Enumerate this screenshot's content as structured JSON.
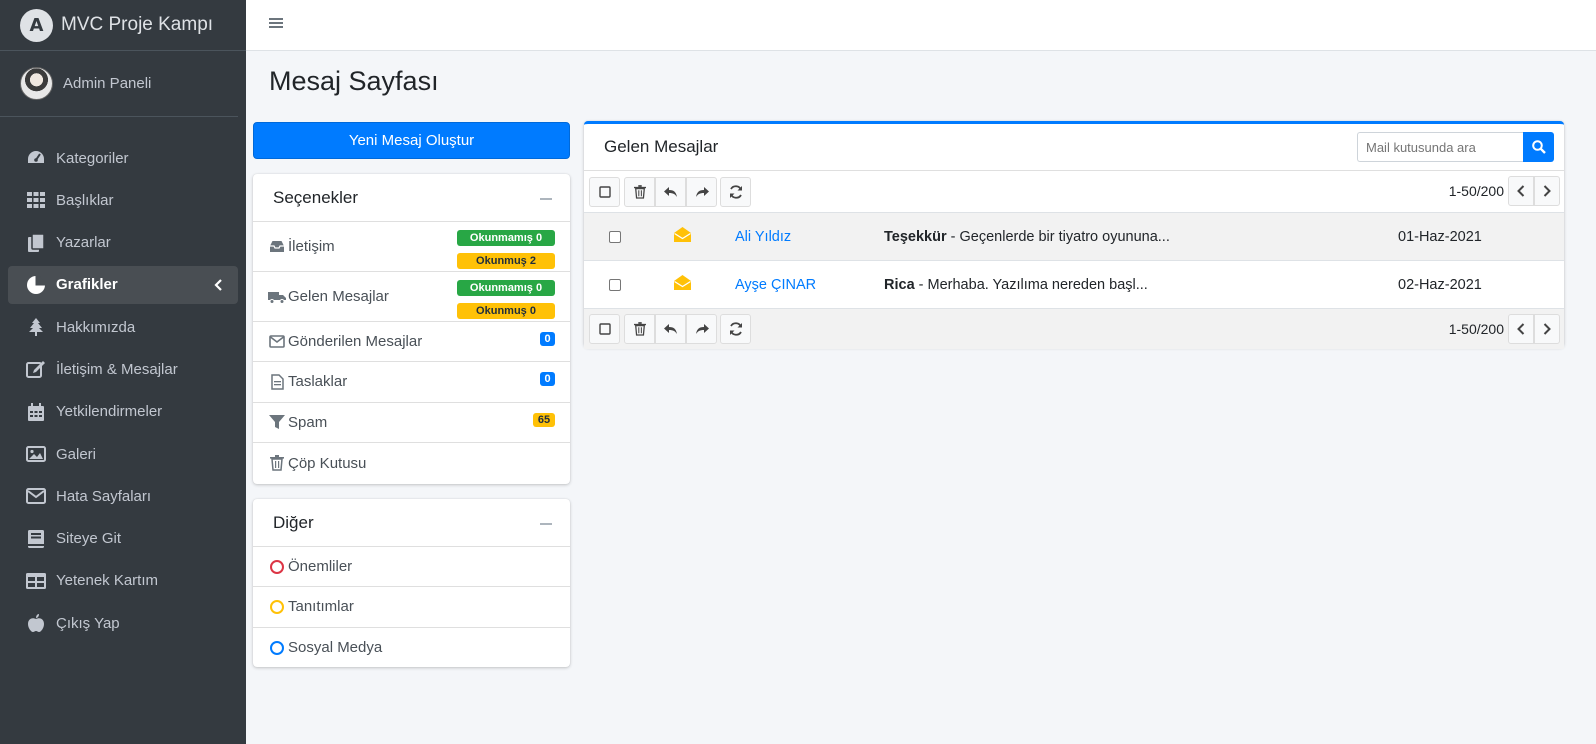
{
  "brand": {
    "logo_letter": "A",
    "title": "MVC Proje Kampı"
  },
  "user": {
    "name": "Admin Paneli"
  },
  "nav": [
    {
      "label": "Kategoriler",
      "icon": "dashboard-icon"
    },
    {
      "label": "Başlıklar",
      "icon": "grid-icon"
    },
    {
      "label": "Yazarlar",
      "icon": "copy-icon"
    },
    {
      "label": "Grafikler",
      "icon": "pie-chart-icon",
      "active": true
    },
    {
      "label": "Hakkımızda",
      "icon": "tree-icon"
    },
    {
      "label": "İletişim & Mesajlar",
      "icon": "edit-icon"
    },
    {
      "label": "Yetkilendirmeler",
      "icon": "calendar-icon"
    },
    {
      "label": "Galeri",
      "icon": "image-icon"
    },
    {
      "label": "Hata Sayfaları",
      "icon": "envelope-icon"
    },
    {
      "label": "Siteye Git",
      "icon": "book-icon"
    },
    {
      "label": "Yetenek Kartım",
      "icon": "table-icon"
    },
    {
      "label": "Çıkış Yap",
      "icon": "apple-icon"
    }
  ],
  "page": {
    "title": "Mesaj Sayfası"
  },
  "compose": {
    "label": "Yeni Mesaj Oluştur"
  },
  "options": {
    "title": "Seçenekler",
    "items": [
      {
        "label": "İletişim",
        "unread": "Okunmamış 0",
        "read": "Okunmuş 2"
      },
      {
        "label": "Gelen Mesajlar",
        "unread": "Okunmamış 0",
        "read": "Okunmuş 0"
      },
      {
        "label": "Gönderilen Mesajlar",
        "count": "0"
      },
      {
        "label": "Taslaklar",
        "count": "0"
      },
      {
        "label": "Spam",
        "count": "65"
      },
      {
        "label": "Çöp Kutusu"
      }
    ]
  },
  "other": {
    "title": "Diğer",
    "items": [
      {
        "label": "Önemliler",
        "color": "#dc3545"
      },
      {
        "label": "Tanıtımlar",
        "color": "#ffc107"
      },
      {
        "label": "Sosyal Medya",
        "color": "#007bff"
      }
    ]
  },
  "inbox": {
    "title": "Gelen Mesajlar",
    "search_placeholder": "Mail kutusunda ara",
    "pager": "1-50/200",
    "messages": [
      {
        "sender": "Ali Yıldız",
        "subject": "Teşekkür",
        "preview": " - Geçenlerde bir tiyatro oyununa...",
        "date": "01-Haz-2021"
      },
      {
        "sender": "Ayşe ÇINAR",
        "subject": "Rica",
        "preview": " - Merhaba. Yazılıma nereden başl...",
        "date": "02-Haz-2021"
      }
    ]
  },
  "colors": {
    "sidebar": "#343a40",
    "primary": "#007bff",
    "success": "#28a745",
    "warning": "#ffc107"
  }
}
